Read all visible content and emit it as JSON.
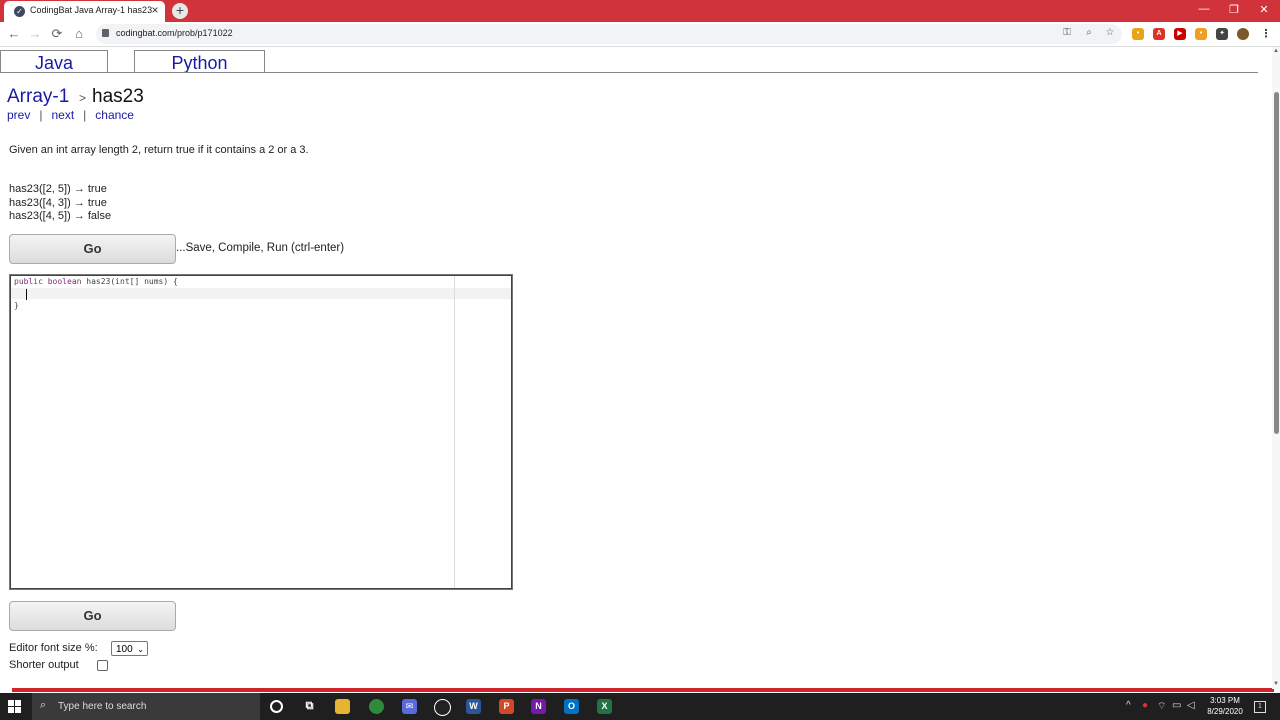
{
  "browser": {
    "tab_title": "CodingBat Java Array-1 has23",
    "tab_favicon": "codingbat-icon",
    "new_tab_symbol": "+",
    "close_symbol": "×",
    "url": "codingbat.com/prob/p171022",
    "window_controls": {
      "minimize": "—",
      "maximize": "❐",
      "close": "✕"
    }
  },
  "page": {
    "tabs": [
      "Java",
      "Python"
    ],
    "breadcrumb": {
      "section": "Array-1",
      "separator": ">",
      "problem": "has23"
    },
    "nav_links": {
      "prev": "prev",
      "next": "next",
      "chance": "chance",
      "sep": "|"
    },
    "prompt": "Given an int array length 2, return true if it contains a 2 or a 3.",
    "examples": [
      "has23([2, 5]) → true",
      "has23([4, 3]) → true",
      "has23([4, 5]) → false"
    ],
    "go_label": "Go",
    "save_hint": "...Save, Compile, Run (ctrl-enter)",
    "code": {
      "kw1": "public",
      "kw2": "boolean",
      "sig_rest": "has23(int[] nums) {",
      "close_brace": "}"
    },
    "font_size_label": "Editor font size %:",
    "font_size_value": "100",
    "shorter_output_label": "Shorter output"
  },
  "taskbar": {
    "search_placeholder": "Type here to search",
    "time": "3:03 PM",
    "date": "8/29/2020",
    "notification_count": "1"
  },
  "colors": {
    "chrome_red": "#d0343a",
    "link_blue": "#1a1aa6",
    "accent_bar": "#d0242a"
  }
}
